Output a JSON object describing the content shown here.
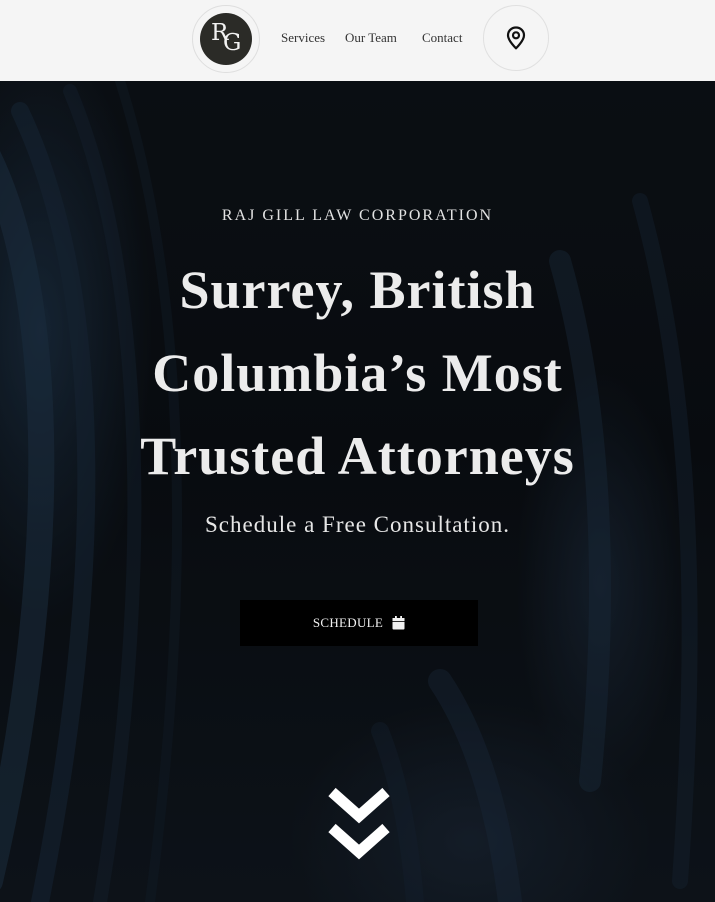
{
  "header": {
    "logo": {
      "letters_top": "R",
      "letters_bottom": "G"
    },
    "nav": [
      {
        "label": "Services"
      },
      {
        "label": "Our Team"
      },
      {
        "label": "Contact"
      }
    ],
    "location_icon": "map-pin-icon"
  },
  "hero": {
    "firm_name": "RAJ GILL LAW CORPORATION",
    "headline_lines": [
      "Surrey, British",
      "Columbia’s Most",
      "Trusted Attorneys"
    ],
    "subheadline": "Schedule a Free Consultation.",
    "cta": {
      "label": "SCHEDULE",
      "icon": "calendar-icon"
    },
    "scroll_icon": "double-chevron-down-icon"
  },
  "colors": {
    "header_bg": "#f5f5f5",
    "hero_bg": "#0b0e12",
    "button_bg": "#000000",
    "text_light": "#ececec"
  }
}
